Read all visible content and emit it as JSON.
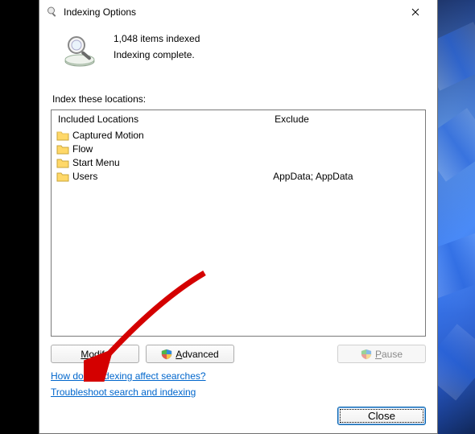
{
  "titlebar": {
    "title": "Indexing Options"
  },
  "status": {
    "count_line": "1,048 items indexed",
    "state_line": "Indexing complete."
  },
  "section_label": "Index these locations:",
  "columns": {
    "included": "Included Locations",
    "exclude": "Exclude"
  },
  "locations": [
    {
      "name": "Captured Motion",
      "exclude": ""
    },
    {
      "name": "Flow",
      "exclude": ""
    },
    {
      "name": "Start Menu",
      "exclude": ""
    },
    {
      "name": "Users",
      "exclude": "AppData; AppData"
    }
  ],
  "buttons": {
    "modify_pre": "",
    "modify_ul": "M",
    "modify_post": "odify",
    "advanced_ul": "A",
    "advanced_post": "dvanced",
    "pause_ul": "P",
    "pause_post": "ause",
    "close": "Close"
  },
  "links": {
    "help": "How does indexing affect searches?",
    "troubleshoot": "Troubleshoot search and indexing"
  }
}
